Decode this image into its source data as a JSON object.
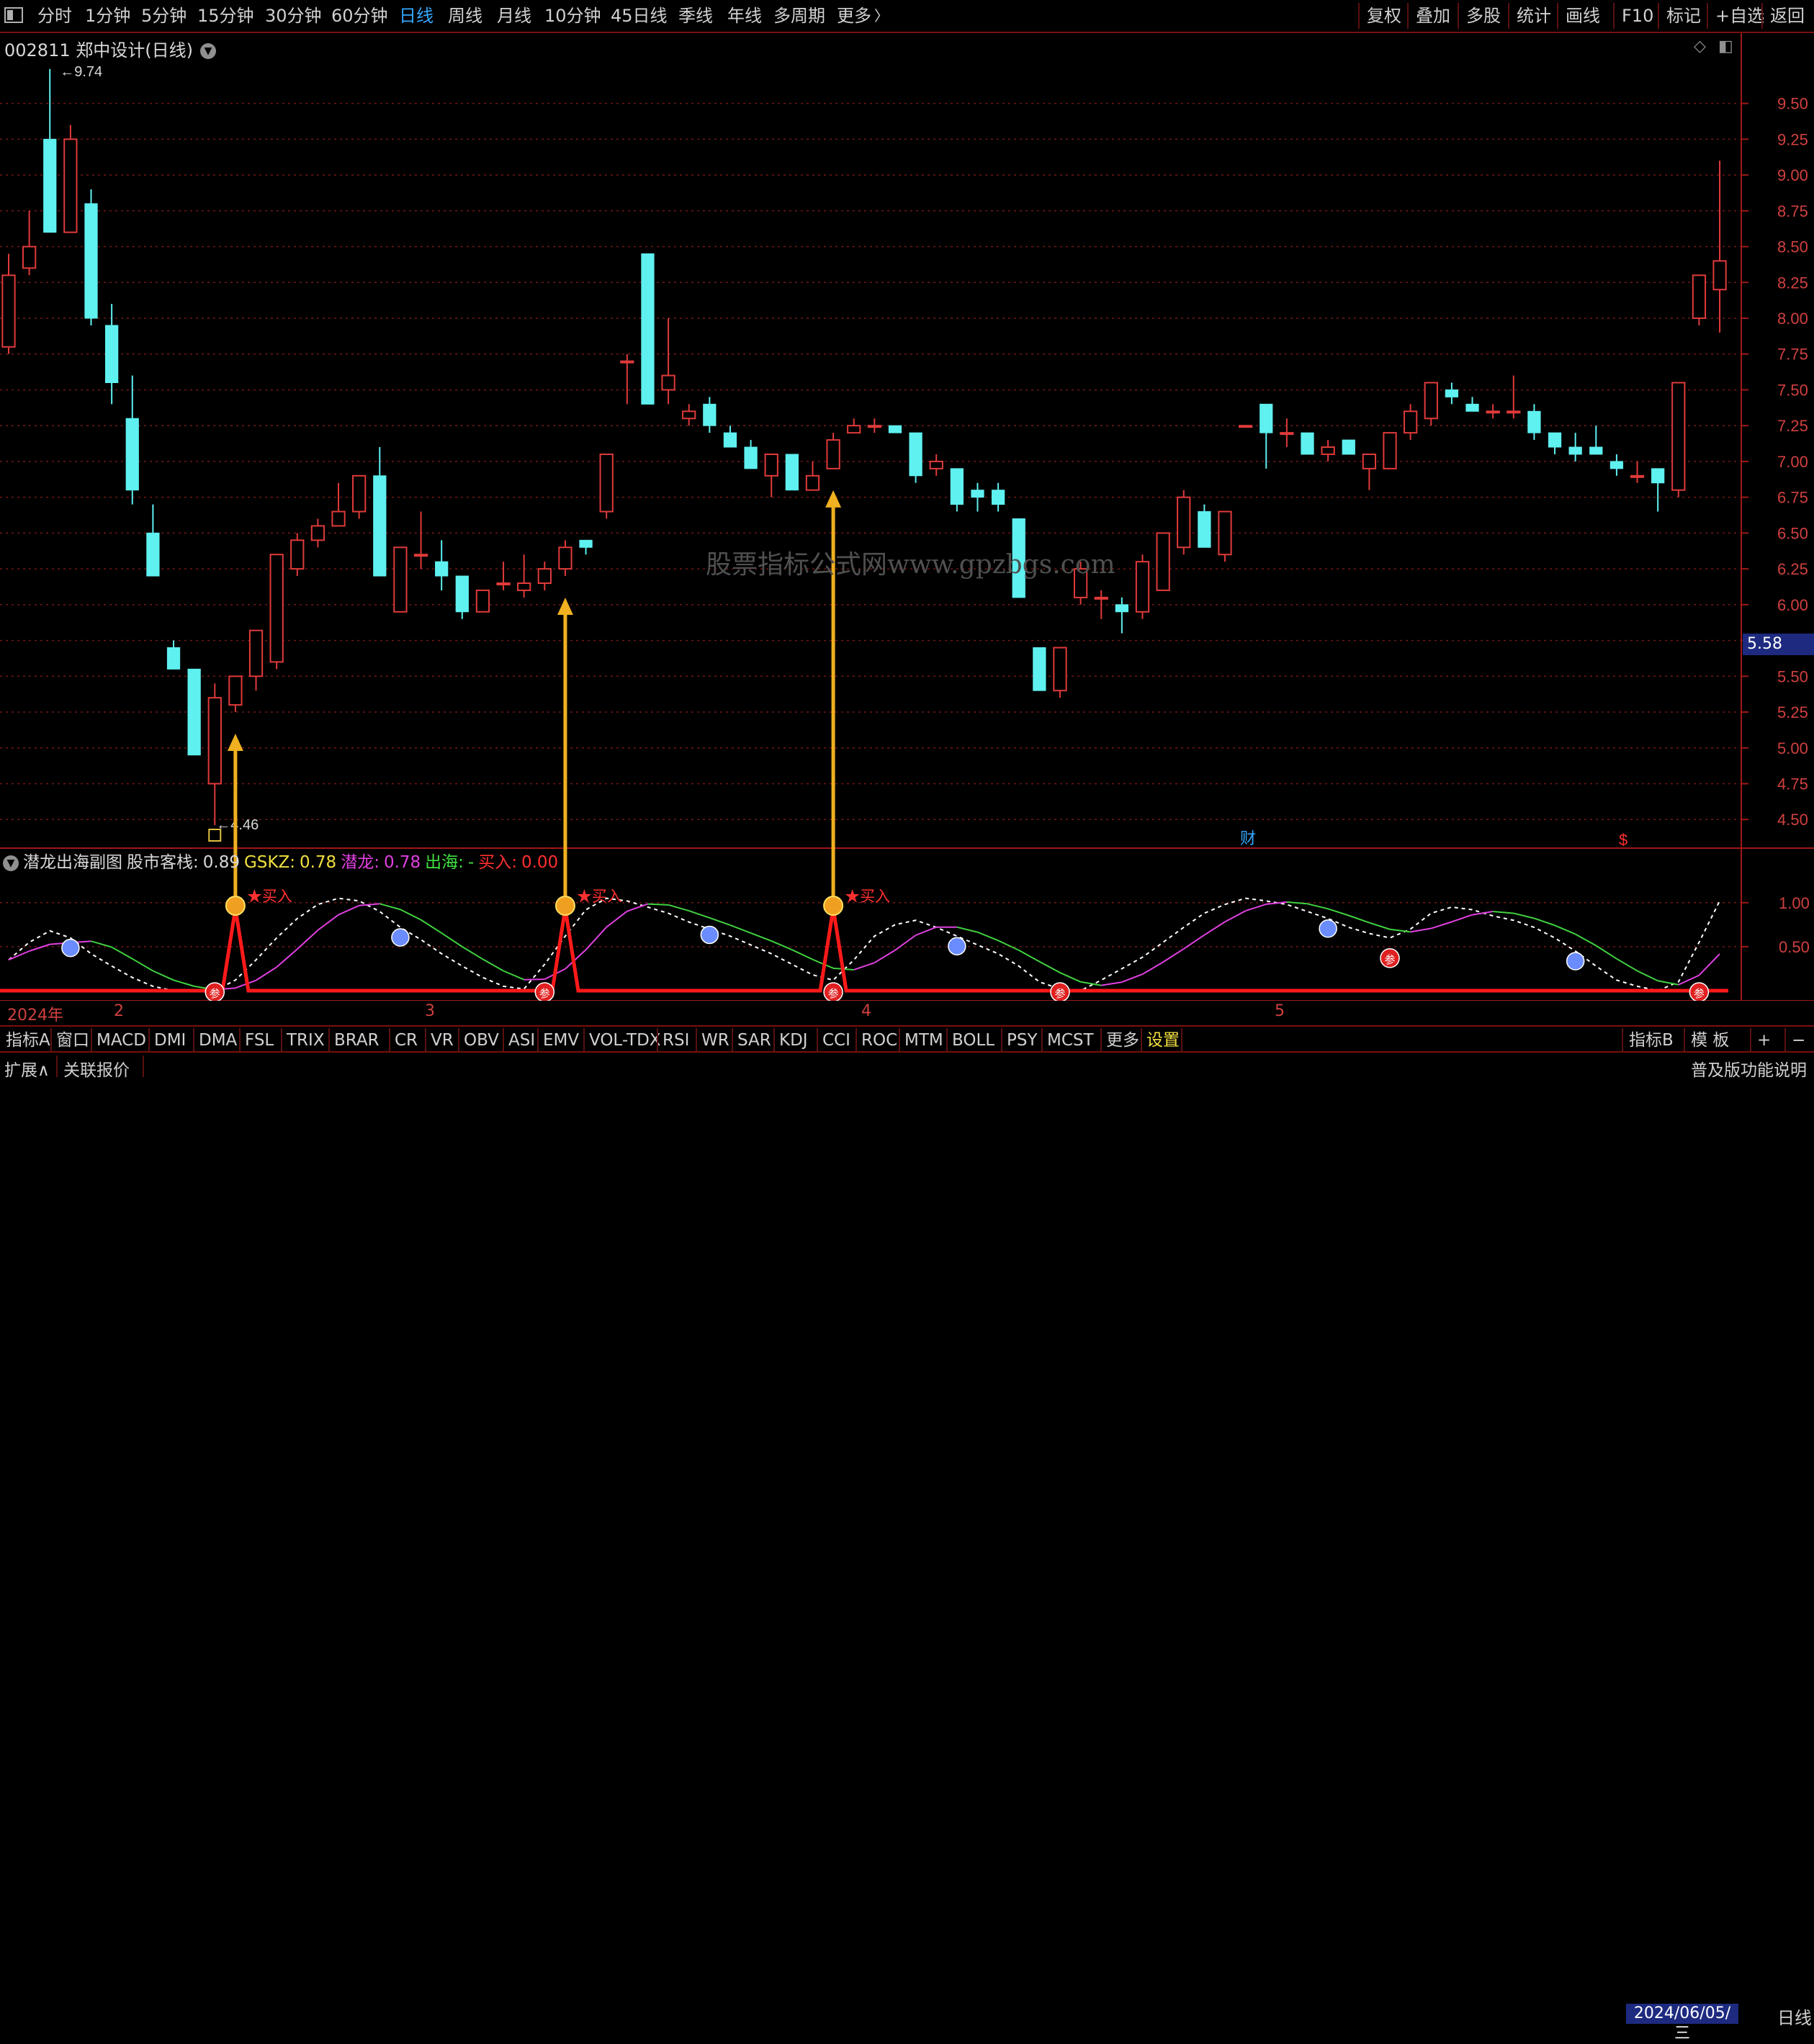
{
  "toolbar": {
    "periods": [
      {
        "label": "分时",
        "active": false
      },
      {
        "label": "1分钟",
        "active": false
      },
      {
        "label": "5分钟",
        "active": false
      },
      {
        "label": "15分钟",
        "active": false
      },
      {
        "label": "30分钟",
        "active": false
      },
      {
        "label": "60分钟",
        "active": false
      },
      {
        "label": "日线",
        "active": true
      },
      {
        "label": "周线",
        "active": false
      },
      {
        "label": "月线",
        "active": false
      },
      {
        "label": "10分钟",
        "active": false
      },
      {
        "label": "45日线",
        "active": false
      },
      {
        "label": "季线",
        "active": false
      },
      {
        "label": "年线",
        "active": false
      },
      {
        "label": "多周期",
        "active": false
      },
      {
        "label": "更多",
        "active": false
      }
    ],
    "right_buttons": [
      "复权",
      "叠加",
      "多股",
      "统计",
      "画线",
      "F10",
      "标记",
      "+自选",
      "返回"
    ]
  },
  "stock": {
    "title": "002811 郑中设计(日线)"
  },
  "price_axis": {
    "ticks": [
      "9.50",
      "9.25",
      "9.00",
      "8.75",
      "8.50",
      "8.25",
      "8.00",
      "7.75",
      "7.50",
      "7.25",
      "7.00",
      "6.75",
      "6.50",
      "6.25",
      "6.00",
      "5.75",
      "5.50",
      "5.25",
      "5.00",
      "4.75",
      "4.50"
    ],
    "current": "5.58"
  },
  "annotations": {
    "high": "9.74",
    "low": "4.46",
    "cai": "财",
    "dollar": "$"
  },
  "watermark": "股票指标公式网www.gpzbgs.com",
  "indicator": {
    "name": "潜龙出海副图",
    "fields": [
      {
        "label": "股市客栈:",
        "value": "0.89",
        "color": "#d8d8d8"
      },
      {
        "label": "GSKZ:",
        "value": "0.78",
        "color": "#f0e040"
      },
      {
        "label": "潜龙:",
        "value": "0.78",
        "color": "#e040e0"
      },
      {
        "label": "出海:",
        "value": "-",
        "color": "#40e040"
      },
      {
        "label": "买入:",
        "value": "0.00",
        "color": "#ff3030"
      }
    ],
    "axis": [
      "1.00",
      "0.50"
    ],
    "buy_label": "★买入",
    "sell_label": "参"
  },
  "date_axis": {
    "labels": [
      "2024年",
      "2",
      "3",
      "4",
      "5"
    ],
    "current_date": "2024/06/05/三",
    "period": "日线"
  },
  "indicator_tabs": [
    "指标A",
    "窗口",
    "MACD",
    "DMI",
    "DMA",
    "FSL",
    "TRIX",
    "BRAR",
    "CR",
    "VR",
    "OBV",
    "ASI",
    "EMV",
    "VOL-TDX",
    "RSI",
    "WR",
    "SAR",
    "KDJ",
    "CCI",
    "ROC",
    "MTM",
    "BOLL",
    "PSY",
    "MCST",
    "更多",
    "设置"
  ],
  "indicator_right": [
    "指标B",
    "模 板",
    "+",
    "−"
  ],
  "status": {
    "left": [
      "扩展∧",
      "关联报价"
    ],
    "right": "普及版功能说明"
  },
  "chart_data": {
    "type": "candlestick",
    "ylim": [
      4.3,
      9.85
    ],
    "candles": [
      [
        7.8,
        8.3,
        7.75,
        8.45
      ],
      [
        8.35,
        8.5,
        8.3,
        8.75
      ],
      [
        9.25,
        8.6,
        8.6,
        9.74
      ],
      [
        8.6,
        9.25,
        8.65,
        9.35
      ],
      [
        8.8,
        8.0,
        7.95,
        8.9
      ],
      [
        7.95,
        7.55,
        7.4,
        8.1
      ],
      [
        7.3,
        6.8,
        6.7,
        7.6
      ],
      [
        6.5,
        6.2,
        6.2,
        6.7
      ],
      [
        5.7,
        5.55,
        5.55,
        5.75
      ],
      [
        5.55,
        4.95,
        4.95,
        5.55
      ],
      [
        4.75,
        5.35,
        4.46,
        5.45
      ],
      [
        5.3,
        5.5,
        5.25,
        5.5
      ],
      [
        5.5,
        5.82,
        5.4,
        5.82
      ],
      [
        5.6,
        6.35,
        5.55,
        6.35
      ],
      [
        6.25,
        6.45,
        6.2,
        6.5
      ],
      [
        6.45,
        6.55,
        6.4,
        6.6
      ],
      [
        6.55,
        6.65,
        6.55,
        6.85
      ],
      [
        6.65,
        6.9,
        6.6,
        6.9
      ],
      [
        6.9,
        6.2,
        6.2,
        7.1
      ],
      [
        5.95,
        6.4,
        5.95,
        6.4
      ],
      [
        6.35,
        6.35,
        6.25,
        6.65
      ],
      [
        6.3,
        6.2,
        6.1,
        6.45
      ],
      [
        6.2,
        5.95,
        5.9,
        6.2
      ],
      [
        5.95,
        6.1,
        5.95,
        6.1
      ],
      [
        6.15,
        6.15,
        6.1,
        6.3
      ],
      [
        6.1,
        6.15,
        6.05,
        6.35
      ],
      [
        6.15,
        6.25,
        6.1,
        6.3
      ],
      [
        6.25,
        6.4,
        6.2,
        6.45
      ],
      [
        6.45,
        6.4,
        6.35,
        6.45
      ],
      [
        6.65,
        7.05,
        6.6,
        7.05
      ],
      [
        7.7,
        7.7,
        7.4,
        7.75
      ],
      [
        8.45,
        7.4,
        7.4,
        8.45
      ],
      [
        7.5,
        7.6,
        7.4,
        8.0
      ],
      [
        7.3,
        7.35,
        7.25,
        7.4
      ],
      [
        7.4,
        7.25,
        7.2,
        7.45
      ],
      [
        7.2,
        7.1,
        7.1,
        7.25
      ],
      [
        7.1,
        6.95,
        6.95,
        7.15
      ],
      [
        6.9,
        7.05,
        6.75,
        7.05
      ],
      [
        7.05,
        6.8,
        6.8,
        7.05
      ],
      [
        6.8,
        6.9,
        6.8,
        7.0
      ],
      [
        6.95,
        7.15,
        6.95,
        7.2
      ],
      [
        7.2,
        7.25,
        7.2,
        7.3
      ],
      [
        7.25,
        7.25,
        7.2,
        7.3
      ],
      [
        7.25,
        7.2,
        7.2,
        7.25
      ],
      [
        7.2,
        6.9,
        6.85,
        7.2
      ],
      [
        6.95,
        7.0,
        6.9,
        7.05
      ],
      [
        6.95,
        6.7,
        6.65,
        6.95
      ],
      [
        6.8,
        6.75,
        6.65,
        6.85
      ],
      [
        6.8,
        6.7,
        6.65,
        6.85
      ],
      [
        6.6,
        6.05,
        6.05,
        6.6
      ],
      [
        5.7,
        5.4,
        5.4,
        5.7
      ],
      [
        5.4,
        5.7,
        5.35,
        5.7
      ],
      [
        6.05,
        6.25,
        6.0,
        6.3
      ],
      [
        6.05,
        6.05,
        5.9,
        6.1
      ],
      [
        6.0,
        5.95,
        5.8,
        6.05
      ],
      [
        5.95,
        6.3,
        5.9,
        6.35
      ],
      [
        6.1,
        6.5,
        6.1,
        6.5
      ],
      [
        6.4,
        6.75,
        6.35,
        6.8
      ],
      [
        6.65,
        6.4,
        6.4,
        6.7
      ],
      [
        6.35,
        6.65,
        6.3,
        6.65
      ],
      [
        7.25,
        7.25,
        7.25,
        7.25
      ],
      [
        7.4,
        7.2,
        6.95,
        7.4
      ],
      [
        7.2,
        7.2,
        7.1,
        7.3
      ],
      [
        7.2,
        7.05,
        7.05,
        7.2
      ],
      [
        7.05,
        7.1,
        7.0,
        7.15
      ],
      [
        7.15,
        7.05,
        7.05,
        7.15
      ],
      [
        6.95,
        7.05,
        6.8,
        7.05
      ],
      [
        6.95,
        7.2,
        6.95,
        7.2
      ],
      [
        7.2,
        7.35,
        7.15,
        7.4
      ],
      [
        7.3,
        7.55,
        7.25,
        7.55
      ],
      [
        7.5,
        7.45,
        7.4,
        7.55
      ],
      [
        7.4,
        7.35,
        7.35,
        7.45
      ],
      [
        7.35,
        7.35,
        7.3,
        7.4
      ],
      [
        7.35,
        7.35,
        7.3,
        7.6
      ],
      [
        7.35,
        7.2,
        7.15,
        7.4
      ],
      [
        7.2,
        7.1,
        7.05,
        7.2
      ],
      [
        7.1,
        7.05,
        7.0,
        7.2
      ],
      [
        7.1,
        7.05,
        7.05,
        7.25
      ],
      [
        7.0,
        6.95,
        6.9,
        7.05
      ],
      [
        6.9,
        6.9,
        6.85,
        7.0
      ],
      [
        6.95,
        6.85,
        6.65,
        6.95
      ],
      [
        6.8,
        7.55,
        6.75,
        7.55
      ],
      [
        8.0,
        8.3,
        7.95,
        8.3
      ],
      [
        8.2,
        8.4,
        7.9,
        9.1
      ]
    ],
    "buy_signals": [
      11,
      27,
      40
    ],
    "sell_signals": [
      10,
      26,
      40,
      51,
      67,
      82
    ]
  }
}
